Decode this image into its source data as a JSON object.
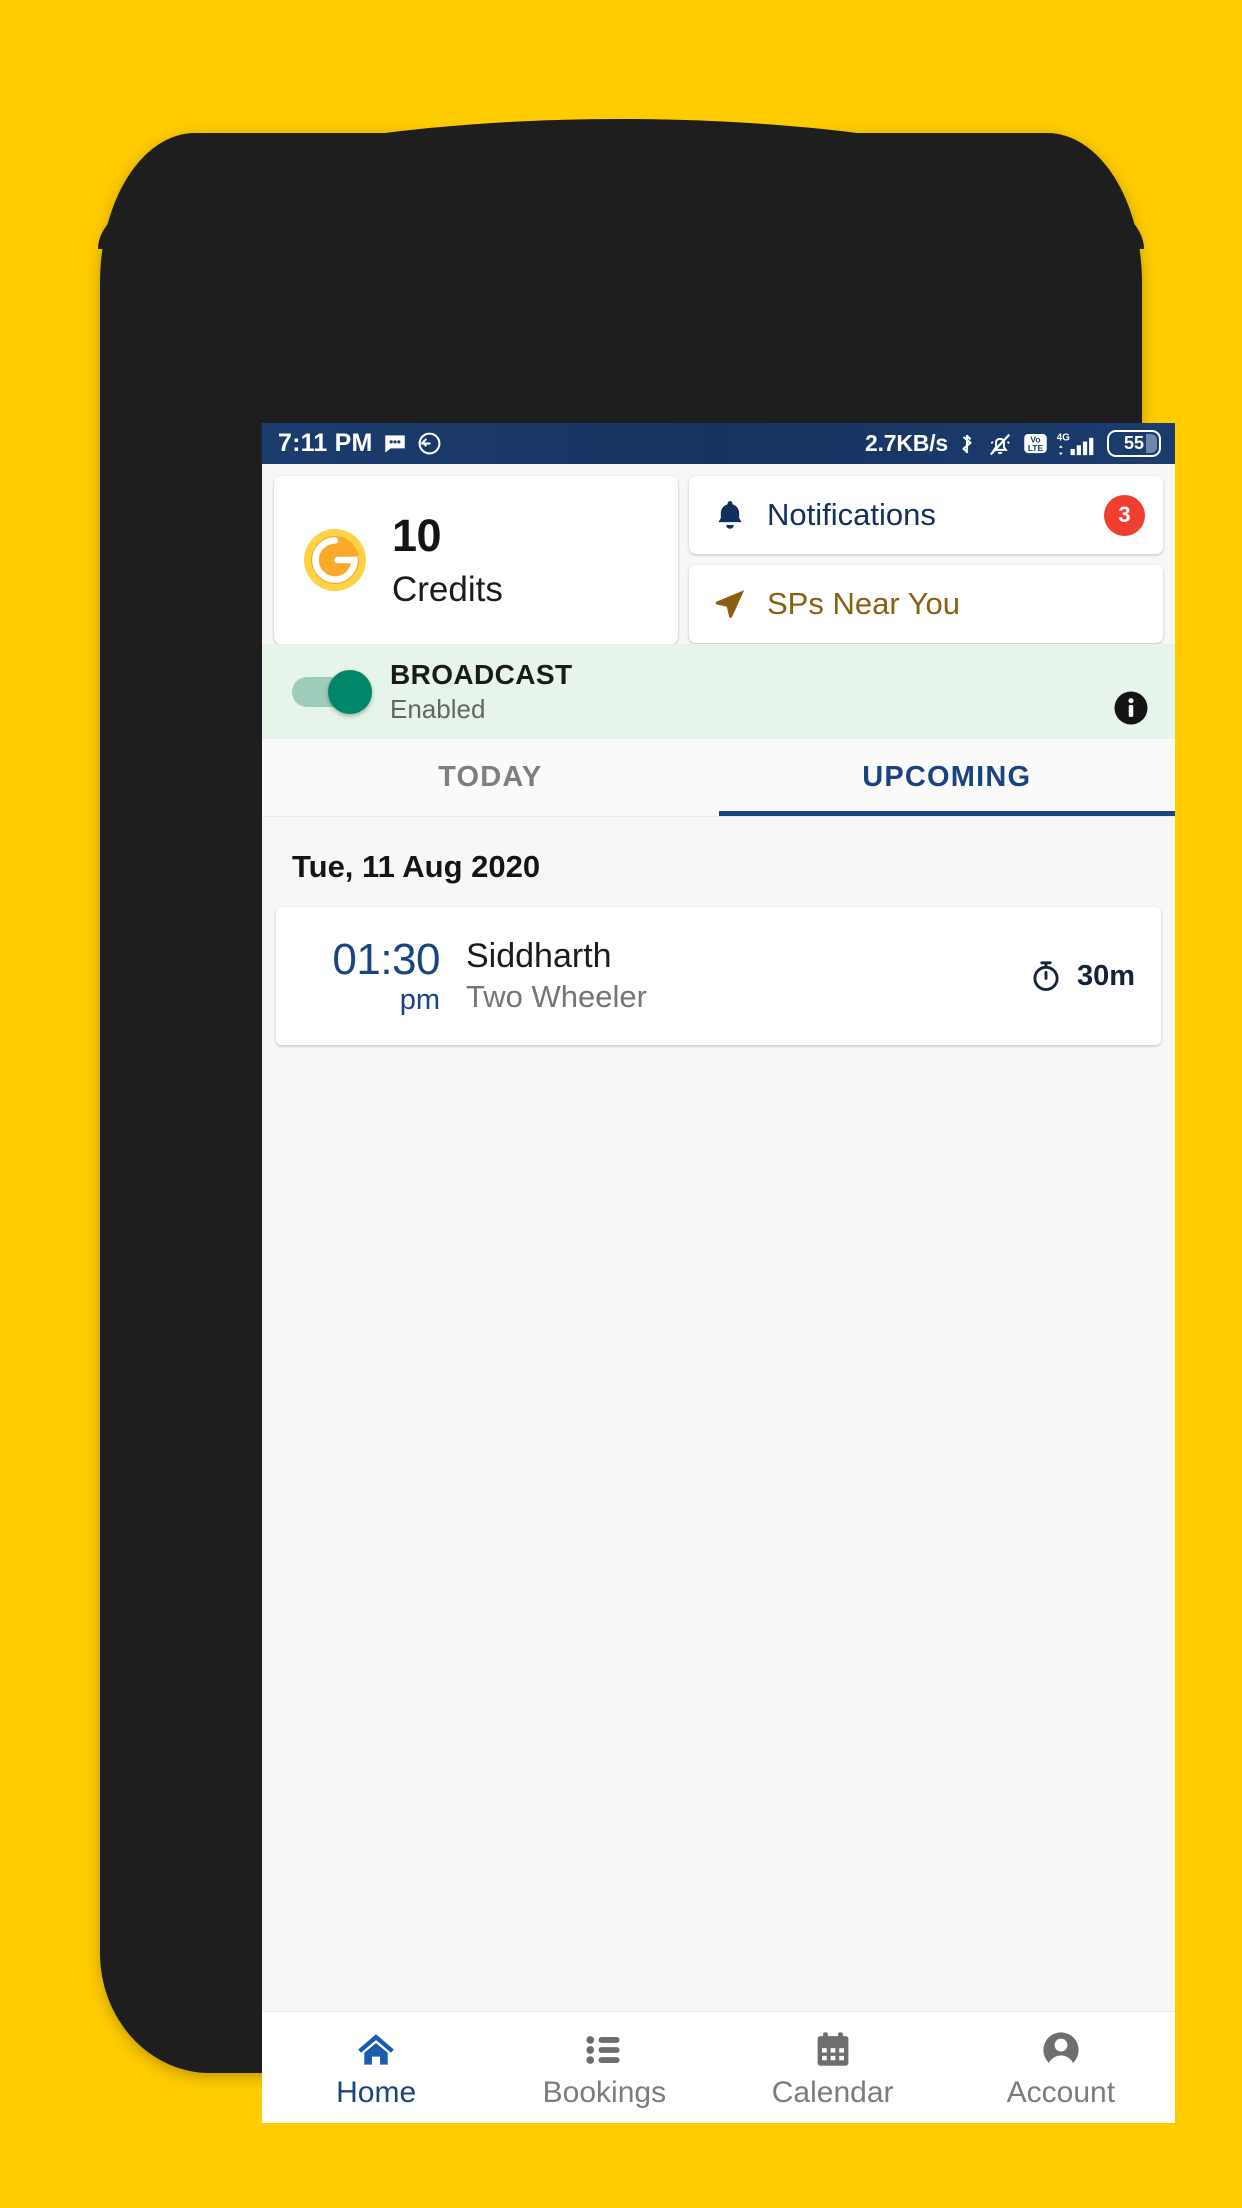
{
  "status_bar": {
    "time": "7:11 PM",
    "icons_left": [
      "message-icon",
      "app-icon"
    ],
    "data_rate": "2.7KB/s",
    "icons_right": [
      "bluetooth-icon",
      "mute-bell-icon",
      "volte-icon",
      "signal-4g-icon"
    ],
    "battery_level": "55"
  },
  "credits_card": {
    "icon": "gold-coin-g-icon",
    "count": "10",
    "label": "Credits"
  },
  "notifications_card": {
    "icon": "bell-icon",
    "label": "Notifications",
    "badge": "3"
  },
  "sps_card": {
    "icon": "navigation-arrow-icon",
    "label": "SPs Near You"
  },
  "broadcast": {
    "title": "BROADCAST",
    "status": "Enabled",
    "toggle_on": true,
    "info_icon": "info-icon"
  },
  "tabs": [
    {
      "label": "TODAY",
      "active": false
    },
    {
      "label": "UPCOMING",
      "active": true
    }
  ],
  "list": {
    "date_header": "Tue, 11 Aug 2020",
    "bookings": [
      {
        "time": "01:30",
        "ampm": "pm",
        "name": "Siddharth",
        "service": "Two Wheeler",
        "duration": "30m",
        "duration_icon": "stopwatch-icon"
      }
    ]
  },
  "bottom_nav": [
    {
      "label": "Home",
      "icon": "home-icon",
      "active": true
    },
    {
      "label": "Bookings",
      "icon": "list-icon",
      "active": false
    },
    {
      "label": "Calendar",
      "icon": "calendar-icon",
      "active": false
    },
    {
      "label": "Account",
      "icon": "account-icon",
      "active": false
    }
  ],
  "colors": {
    "page_background": "#FFCC00",
    "status_bar": "#1B3A6B",
    "accent_navy": "#1A4480",
    "badge_red": "#F03E2F",
    "toggle_green": "#00876A",
    "broadcast_background": "#E6F4EA",
    "sps_brown": "#8A5F10"
  }
}
